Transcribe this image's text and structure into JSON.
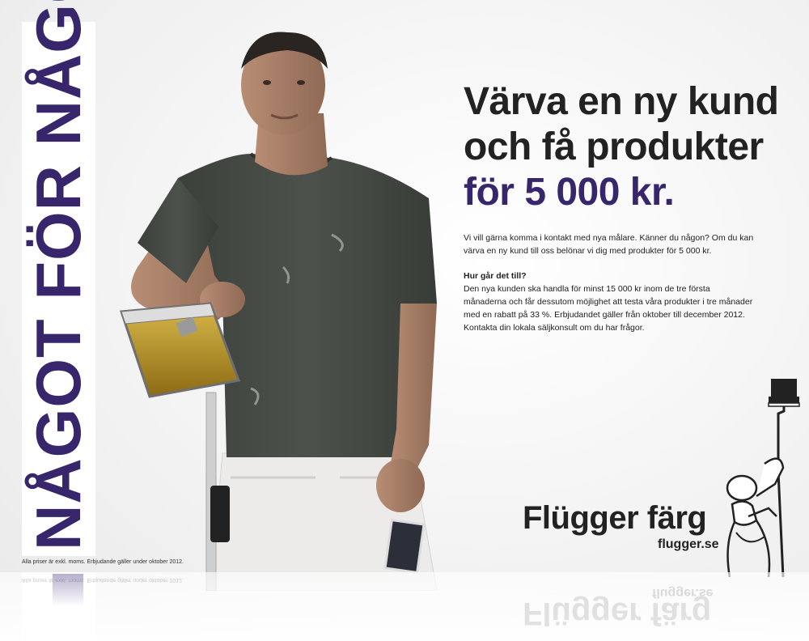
{
  "banner": {
    "text": "NÅGOT FÖR NÅGOT",
    "color": "#37266b"
  },
  "headline": {
    "line1": "Värva en ny kund",
    "line2": "och få produkter",
    "line3": "för 5 000 kr."
  },
  "body": {
    "intro": "Vi vill gärna komma i kontakt med nya målare. Känner du någon? Om du kan värva en ny kund till oss belönar vi dig med produkter för 5 000 kr.",
    "question": "Hur går det till?",
    "details": "Den nya kunden ska handla för minst 15 000 kr inom de tre första månaderna och får dessutom möjlighet att testa våra produkter i tre månader med en rabatt på 33 %. Erbjudandet gäller från oktober till december 2012. Kontakta din lokala säljkonsult om du har frågor."
  },
  "footnote": "Alla priser är exkl. moms. Erbjudande gäller under oktober 2012.",
  "brand": {
    "name": "Flügger färg",
    "website": "flugger.se"
  },
  "colors": {
    "accent": "#37266b",
    "text": "#222222"
  },
  "icons": {
    "painter": "painter-logo-icon"
  }
}
